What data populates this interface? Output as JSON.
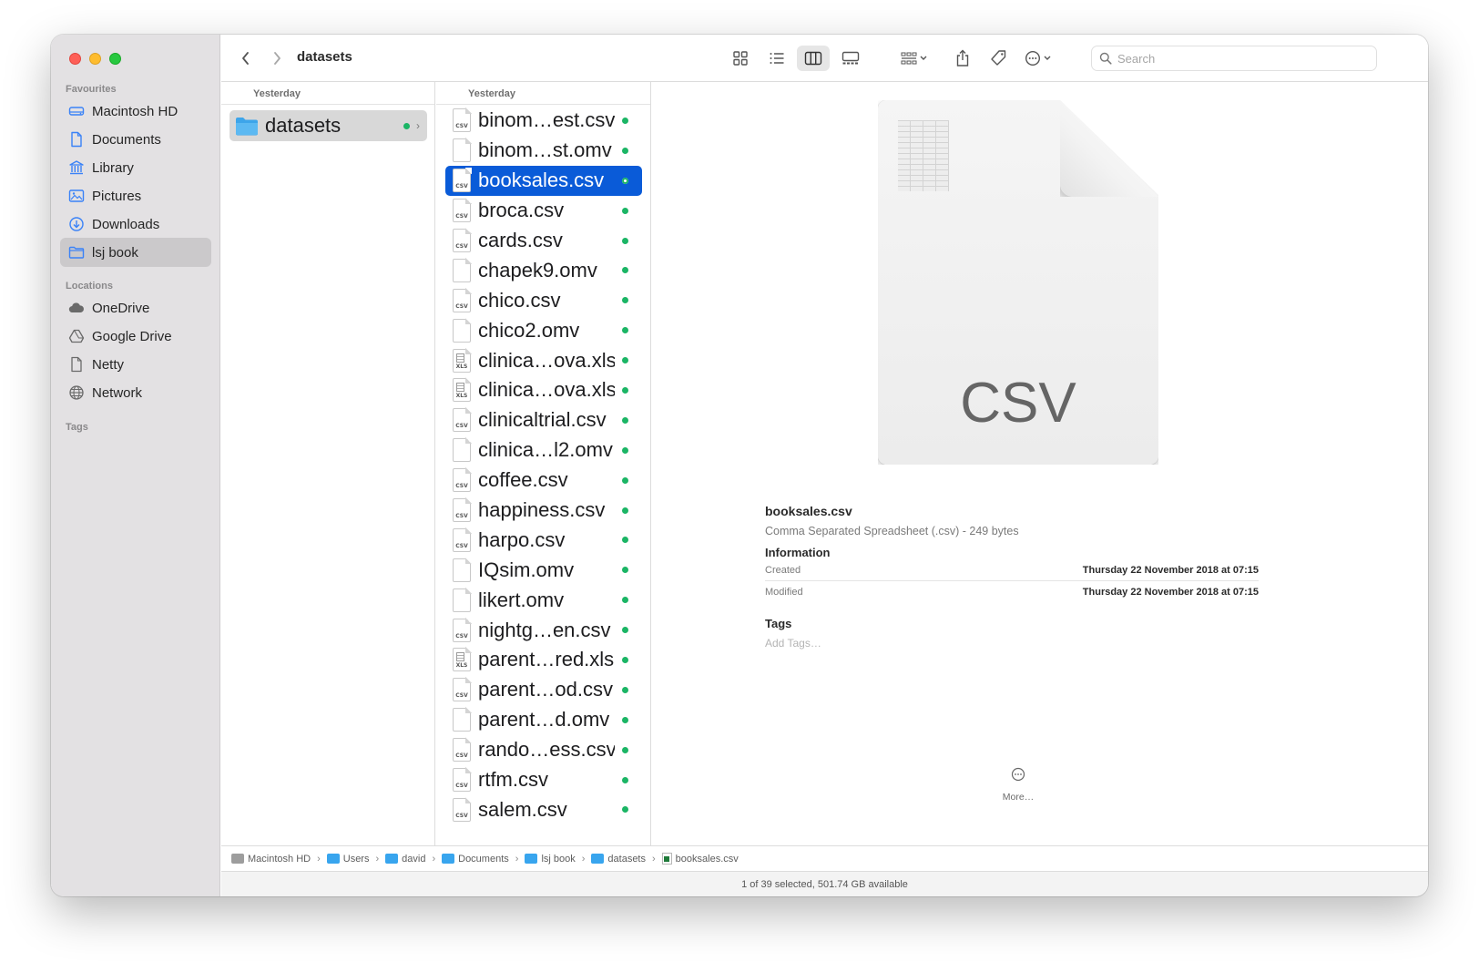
{
  "sidebar": {
    "favourites_label": "Favourites",
    "locations_label": "Locations",
    "tags_label": "Tags",
    "favourites": [
      {
        "label": "Macintosh HD",
        "icon": "hard-drive-icon"
      },
      {
        "label": "Documents",
        "icon": "document-icon"
      },
      {
        "label": "Library",
        "icon": "library-icon"
      },
      {
        "label": "Pictures",
        "icon": "pictures-icon"
      },
      {
        "label": "Downloads",
        "icon": "downloads-icon"
      },
      {
        "label": "lsj book",
        "icon": "folder-icon",
        "active": true
      }
    ],
    "locations": [
      {
        "label": "OneDrive",
        "icon": "cloud-icon"
      },
      {
        "label": "Google Drive",
        "icon": "drive-icon"
      },
      {
        "label": "Netty",
        "icon": "document-icon"
      },
      {
        "label": "Network",
        "icon": "globe-icon"
      }
    ]
  },
  "toolbar": {
    "title": "datasets",
    "search_placeholder": "Search",
    "icons": [
      "back-icon",
      "forward-icon",
      "icon-view-icon",
      "list-view-icon",
      "column-view-icon",
      "gallery-view-icon",
      "group-icon",
      "share-icon",
      "tag-icon",
      "more-actions-icon",
      "search-icon"
    ]
  },
  "column1": {
    "header": "Yesterday",
    "folder": "datasets"
  },
  "column2": {
    "header": "Yesterday",
    "files": [
      {
        "name": "binom…est.csv",
        "ext": "CSV"
      },
      {
        "name": "binom…st.omv",
        "ext": ""
      },
      {
        "name": "booksales.csv",
        "ext": "CSV",
        "selected": true
      },
      {
        "name": "broca.csv",
        "ext": "CSV"
      },
      {
        "name": "cards.csv",
        "ext": "CSV"
      },
      {
        "name": "chapek9.omv",
        "ext": ""
      },
      {
        "name": "chico.csv",
        "ext": "CSV"
      },
      {
        "name": "chico2.omv",
        "ext": ""
      },
      {
        "name": "clinica…ova.xls",
        "ext": "XLS"
      },
      {
        "name": "clinica…ova.xls",
        "ext": "XLS"
      },
      {
        "name": "clinicaltrial.csv",
        "ext": "CSV"
      },
      {
        "name": "clinica…l2.omv",
        "ext": ""
      },
      {
        "name": "coffee.csv",
        "ext": "CSV"
      },
      {
        "name": "happiness.csv",
        "ext": "CSV"
      },
      {
        "name": "harpo.csv",
        "ext": "CSV"
      },
      {
        "name": "IQsim.omv",
        "ext": ""
      },
      {
        "name": "likert.omv",
        "ext": ""
      },
      {
        "name": "nightg…en.csv",
        "ext": "CSV"
      },
      {
        "name": "parent…red.xls",
        "ext": "XLS"
      },
      {
        "name": "parent…od.csv",
        "ext": "CSV"
      },
      {
        "name": "parent…d.omv",
        "ext": ""
      },
      {
        "name": "rando…ess.csv",
        "ext": "CSV"
      },
      {
        "name": "rtfm.csv",
        "ext": "CSV"
      },
      {
        "name": "salem.csv",
        "ext": "CSV"
      }
    ]
  },
  "preview": {
    "icon_label": "CSV",
    "filename": "booksales.csv",
    "kind": "Comma Separated Spreadsheet (.csv) - 249 bytes",
    "info_label": "Information",
    "created_label": "Created",
    "created_value": "Thursday 22 November 2018 at 07:15",
    "modified_label": "Modified",
    "modified_value": "Thursday 22 November 2018 at 07:15",
    "tags_label": "Tags",
    "add_tags": "Add Tags…",
    "more_label": "More…"
  },
  "pathbar": [
    {
      "label": "Macintosh HD",
      "icon": "hard-drive-icon"
    },
    {
      "label": "Users",
      "icon": "folder-icon"
    },
    {
      "label": "david",
      "icon": "folder-icon"
    },
    {
      "label": "Documents",
      "icon": "folder-icon"
    },
    {
      "label": "lsj book",
      "icon": "folder-icon"
    },
    {
      "label": "datasets",
      "icon": "folder-icon"
    },
    {
      "label": "booksales.csv",
      "icon": "spreadsheet-icon"
    }
  ],
  "status": "1 of 39 selected, 501.74 GB available",
  "colors": {
    "accent": "#0a5bd8",
    "tag_green": "#1bb565",
    "sidebar_bg": "#e3e1e3"
  }
}
